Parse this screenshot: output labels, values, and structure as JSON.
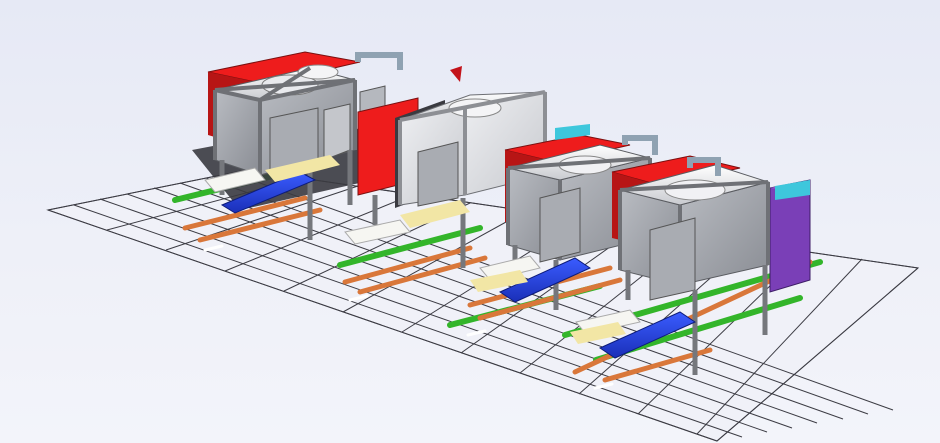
{
  "scene": {
    "kind": "3d-simulation-viewport",
    "background_color": "#eceef7",
    "grid_color": "#3c3c44",
    "units": [
      {
        "id": "cell-1",
        "label": "",
        "accent": "red",
        "panel_color": "#ee1c1c"
      },
      {
        "id": "cell-2",
        "label": "",
        "accent": "white",
        "panel_color": "#ee1c1c"
      },
      {
        "id": "cell-3",
        "label": "",
        "accent": "red",
        "panel_color": "#ee1c1c"
      },
      {
        "id": "cell-4",
        "label": "",
        "accent": "purple",
        "panel_color": "#7a3fb7"
      }
    ],
    "colors": {
      "frame": "#8d8f94",
      "box_side": "#9ea1a8",
      "box_side_light": "#d8dade",
      "red_panel": "#ee1c1c",
      "conveyor_belt": "#1f3fd8",
      "rail_green": "#33b52a",
      "rail_orange": "#d9773a",
      "sheet_yellow": "#f2e6a5",
      "sheet_white": "#f6f6f2",
      "cyan_block": "#3ec7dc",
      "purple_panel": "#7a3fb7"
    }
  }
}
